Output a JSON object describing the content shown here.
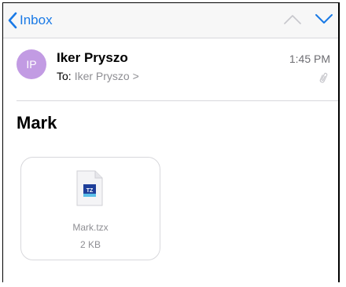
{
  "nav": {
    "back_label": "Inbox"
  },
  "message": {
    "avatar_initials": "IP",
    "sender": "Iker Pryszo",
    "to_label": "To:",
    "to_name": "Iker Pryszo >",
    "time": "1:45 PM",
    "subject": "Mark"
  },
  "attachment": {
    "name": "Mark.tzx",
    "size": "2 KB",
    "icon_badge": "TZ"
  },
  "colors": {
    "accent": "#1a7ae6",
    "avatar": "#c29be3",
    "secondary_text": "#8e8e93"
  }
}
